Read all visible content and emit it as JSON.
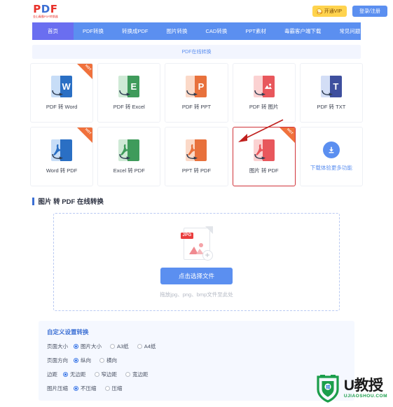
{
  "header": {
    "logo_main_left": "P",
    "logo_main_mid": "D",
    "logo_main_right": "F",
    "logo_sub": "金山毒霸PDF转换器",
    "vip_button": "开通VIP",
    "login_button": "登录/注册"
  },
  "nav": {
    "items": [
      {
        "label": "首页",
        "active": true
      },
      {
        "label": "PDF转换",
        "active": false
      },
      {
        "label": "转换成PDF",
        "active": false
      },
      {
        "label": "图片转换",
        "active": false
      },
      {
        "label": "CAD转换",
        "active": false
      },
      {
        "label": "PPT素材",
        "active": false
      },
      {
        "label": "毒霸客户端下载",
        "active": false
      },
      {
        "label": "常见问题",
        "active": false
      }
    ]
  },
  "banner": {
    "label": "PDF在线转换"
  },
  "cards": {
    "row1": [
      {
        "label": "PDF 转 Word",
        "icon": "word-file-icon",
        "glyph": "W",
        "back": "#c7ddf7",
        "front": "#2a6fc4",
        "hot": true,
        "selected": false
      },
      {
        "label": "PDF 转 Excel",
        "icon": "excel-file-icon",
        "glyph": "E",
        "back": "#cfead6",
        "front": "#3f9b5b",
        "hot": false,
        "selected": false
      },
      {
        "label": "PDF 转 PPT",
        "icon": "ppt-file-icon",
        "glyph": "P",
        "back": "#fbd9c8",
        "front": "#e8713c",
        "hot": false,
        "selected": false
      },
      {
        "label": "PDF 转 图片",
        "icon": "image-file-icon",
        "glyph": "🖼",
        "back": "#fbd2d2",
        "front": "#e8575c",
        "hot": false,
        "selected": false
      },
      {
        "label": "PDF 转 TXT",
        "icon": "txt-file-icon",
        "glyph": "T",
        "back": "#d3def6",
        "front": "#3e4f9e",
        "hot": false,
        "selected": false
      }
    ],
    "row2": [
      {
        "label": "Word 转 PDF",
        "icon": "pdf-from-word-icon",
        "glyph": "A",
        "back": "#c7ddf7",
        "front": "#2a6fc4",
        "hot": true,
        "selected": false
      },
      {
        "label": "Excel 转 PDF",
        "icon": "pdf-from-excel-icon",
        "glyph": "A",
        "back": "#cfead6",
        "front": "#3f9b5b",
        "hot": false,
        "selected": false
      },
      {
        "label": "PPT 转 PDF",
        "icon": "pdf-from-ppt-icon",
        "glyph": "A",
        "back": "#fbd9c8",
        "front": "#e8713c",
        "hot": false,
        "selected": false
      },
      {
        "label": "图片 转 PDF",
        "icon": "pdf-from-image-icon",
        "glyph": "A",
        "back": "#fbd2d2",
        "front": "#e8575c",
        "hot": true,
        "selected": true
      }
    ],
    "download": {
      "label": "下载体验更多功能",
      "icon": "download-icon"
    }
  },
  "section": {
    "title": "图片 转 PDF 在线转换"
  },
  "dropzone": {
    "file_tag": "JPG",
    "select_button": "点击选择文件",
    "hint": "拖放jpg、png、bmp文件至此处"
  },
  "settings": {
    "title": "自定义设置转换",
    "rows": [
      {
        "label": "页面大小",
        "options": [
          {
            "label": "图片大小",
            "selected": true
          },
          {
            "label": "A3纸",
            "selected": false
          },
          {
            "label": "A4纸",
            "selected": false
          }
        ]
      },
      {
        "label": "页面方向",
        "options": [
          {
            "label": "纵向",
            "selected": true
          },
          {
            "label": "横向",
            "selected": false
          }
        ]
      },
      {
        "label": "边距",
        "options": [
          {
            "label": "无边距",
            "selected": true
          },
          {
            "label": "窄边距",
            "selected": false
          },
          {
            "label": "宽边距",
            "selected": false
          }
        ]
      },
      {
        "label": "图片压缩",
        "options": [
          {
            "label": "不压缩",
            "selected": true
          },
          {
            "label": "压缩",
            "selected": false
          }
        ]
      }
    ]
  },
  "watermark": {
    "main": "U教授",
    "sub": "UJIAOSHOU.COM"
  },
  "annotations": {
    "hot_badge_text": "HOT",
    "arrow_color": "#c0201e",
    "highlight_color": "#d0343a"
  },
  "colors": {
    "nav_bg": "#5b8ff0",
    "nav_active": "#6a6ef0",
    "accent": "#3b6fd4",
    "banner_bg": "#f2f5fe",
    "settings_bg": "#f5f8ff"
  }
}
